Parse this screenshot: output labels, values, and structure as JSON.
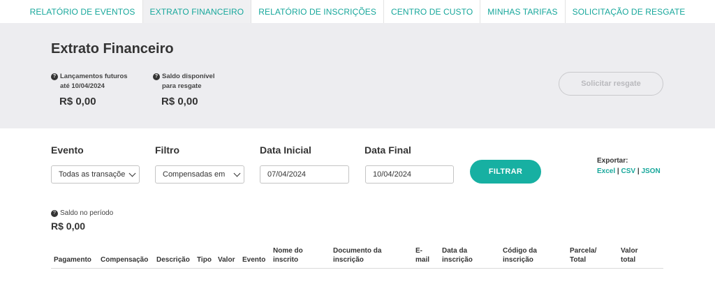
{
  "topnav": {
    "tabs": [
      {
        "label": "RELATÓRIO DE EVENTOS",
        "active": false
      },
      {
        "label": "EXTRATO FINANCEIRO",
        "active": true
      },
      {
        "label": "RELATÓRIO DE INSCRIÇÕES",
        "active": false
      },
      {
        "label": "CENTRO DE CUSTO",
        "active": false
      },
      {
        "label": "MINHAS TARIFAS",
        "active": false
      },
      {
        "label": "SOLICITAÇÃO DE RESGATE",
        "active": false
      }
    ]
  },
  "summary": {
    "title": "Extrato Financeiro",
    "futuros_label_1": "Lançamentos futuros",
    "futuros_label_2": "até 10/04/2024",
    "futuros_value": "R$ 0,00",
    "disponivel_label_1": "Saldo disponível",
    "disponivel_label_2": "para resgate",
    "disponivel_value": "R$ 0,00",
    "resgate_button": "Solicitar resgate",
    "help_icon_glyph": "?"
  },
  "filters": {
    "evento_label": "Evento",
    "evento_value": "Todas as transaçõe",
    "filtro_label": "Filtro",
    "filtro_value": "Compensadas em",
    "data_inicial_label": "Data Inicial",
    "data_inicial_value": "07/04/2024",
    "data_final_label": "Data Final",
    "data_final_value": "10/04/2024",
    "filtrar_button": "FILTRAR"
  },
  "export": {
    "label": "Exportar:",
    "excel": "Excel",
    "csv": "CSV",
    "json": "JSON",
    "sep": "|"
  },
  "periodo": {
    "label": "Saldo no período",
    "value": "R$ 0,00"
  },
  "table": {
    "headers": [
      {
        "line1": "",
        "line2": "Pagamento"
      },
      {
        "line1": "",
        "line2": "Compensação"
      },
      {
        "line1": "",
        "line2": "Descrição"
      },
      {
        "line1": "",
        "line2": "Tipo"
      },
      {
        "line1": "",
        "line2": "Valor"
      },
      {
        "line1": "",
        "line2": "Evento"
      },
      {
        "line1": "Nome do",
        "line2": "inscrito"
      },
      {
        "line1": "Documento da",
        "line2": "inscrição"
      },
      {
        "line1": "E-",
        "line2": "mail"
      },
      {
        "line1": "Data da",
        "line2": "inscrição"
      },
      {
        "line1": "Código da",
        "line2": "inscrição"
      },
      {
        "line1": "Parcela/",
        "line2": "Total"
      },
      {
        "line1": "Valor",
        "line2": "total"
      }
    ]
  },
  "colors": {
    "accent": "#17a79b",
    "button": "#17b0a2",
    "band": "#ededf0"
  }
}
